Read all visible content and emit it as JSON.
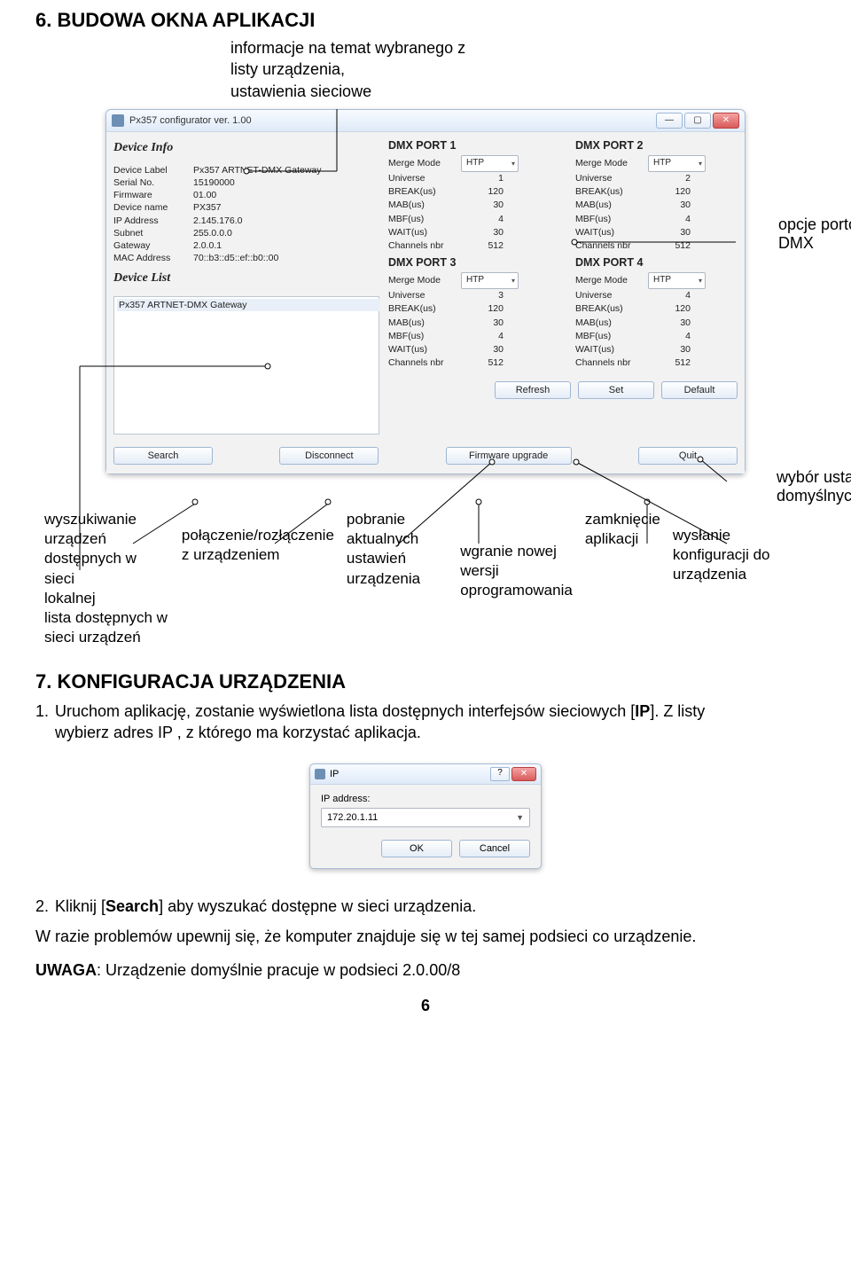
{
  "section6_title": "6. BUDOWA OKNA APLIKACJI",
  "intro_line1": "informacje na temat wybranego z",
  "intro_line2": "listy urządzenia,",
  "intro_line3": "ustawienia sieciowe",
  "callout_opcje1": "opcje portów",
  "callout_opcje2": "DMX",
  "callout_wybor1": "wybór ustawień",
  "callout_wybor2": "domyślnych",
  "cb1a": "wyszukiwanie urządzeń",
  "cb1b": "dostępnych w sieci",
  "cb1c": "lokalnej",
  "cb_lista1": "lista dostępnych w",
  "cb_lista2": "sieci urządzeń",
  "cb2a": "połączenie/rozłączenie",
  "cb2b": "z urządzeniem",
  "cb3a": "pobranie aktualnych",
  "cb3b": "ustawień urządzenia",
  "cb4a": "wgranie nowej wersji",
  "cb4b": "oprogramowania",
  "cb5a": "zamknięcie",
  "cb5b": "aplikacji",
  "cb6a": "wysłanie konfiguracji do",
  "cb6b": "urządzenia",
  "section7_title": "7. KONFIGURACJA URZĄDZENIA",
  "step1a": "Uruchom aplikację, zostanie wyświetlona lista dostępnych interfejsów sieciowych [",
  "step1b": "IP",
  "step1c": "]. Z listy",
  "step1d": "wybierz adres IP , z którego ma korzystać aplikacja.",
  "step2a": "Kliknij [",
  "step2b": "Search",
  "step2c": "] aby wyszukać dostępne w sieci urządzenia.",
  "step2_warn": "W razie problemów upewnij się, że komputer znajduje się w tej samej podsieci co urządzenie.",
  "uwaga_label": "UWAGA",
  "uwaga_text": ": Urządzenie domyślnie pracuje w podsieci 2.0.00/8",
  "page_number": "6",
  "app": {
    "title": "Px357 configurator ver. 1.00",
    "device_info": "Device Info",
    "device_list": "Device List",
    "info": {
      "k1": "Device Label",
      "v1": "Px357 ARTNET-DMX Gateway",
      "k2": "Serial No.",
      "v2": "15190000",
      "k3": "Firmware",
      "v3": "01.00",
      "k4": "Device name",
      "v4": "PX357",
      "k5": "IP Address",
      "v5": "2.145.176.0",
      "k6": "Subnet",
      "v6": "255.0.0.0",
      "k7": "Gateway",
      "v7": "2.0.0.1",
      "k8": "MAC Address",
      "v8": "70::b3::d5::ef::b0::00"
    },
    "listitem": "Px357 ARTNET-DMX Gateway",
    "ports": [
      {
        "title": "DMX PORT 1",
        "merge": "HTP",
        "uni": "1",
        "break": "120",
        "mab": "30",
        "mbf": "4",
        "wait": "30",
        "ch": "512"
      },
      {
        "title": "DMX PORT 2",
        "merge": "HTP",
        "uni": "2",
        "break": "120",
        "mab": "30",
        "mbf": "4",
        "wait": "30",
        "ch": "512"
      },
      {
        "title": "DMX PORT 3",
        "merge": "HTP",
        "uni": "3",
        "break": "120",
        "mab": "30",
        "mbf": "4",
        "wait": "30",
        "ch": "512"
      },
      {
        "title": "DMX PORT 4",
        "merge": "HTP",
        "uni": "4",
        "break": "120",
        "mab": "30",
        "mbf": "4",
        "wait": "30",
        "ch": "512"
      }
    ],
    "labels": {
      "merge": "Merge Mode",
      "uni": "Universe",
      "break": "BREAK(us)",
      "mab": "MAB(us)",
      "mbf": "MBF(us)",
      "wait": "WAIT(us)",
      "ch": "Channels nbr"
    },
    "btns": {
      "refresh": "Refresh",
      "set": "Set",
      "default": "Default",
      "search": "Search",
      "disconnect": "Disconnect",
      "fw": "Firmware upgrade",
      "quit": "Quit"
    }
  },
  "ipdlg": {
    "title": "IP",
    "label": "IP address:",
    "value": "172.20.1.11",
    "ok": "OK",
    "cancel": "Cancel"
  }
}
